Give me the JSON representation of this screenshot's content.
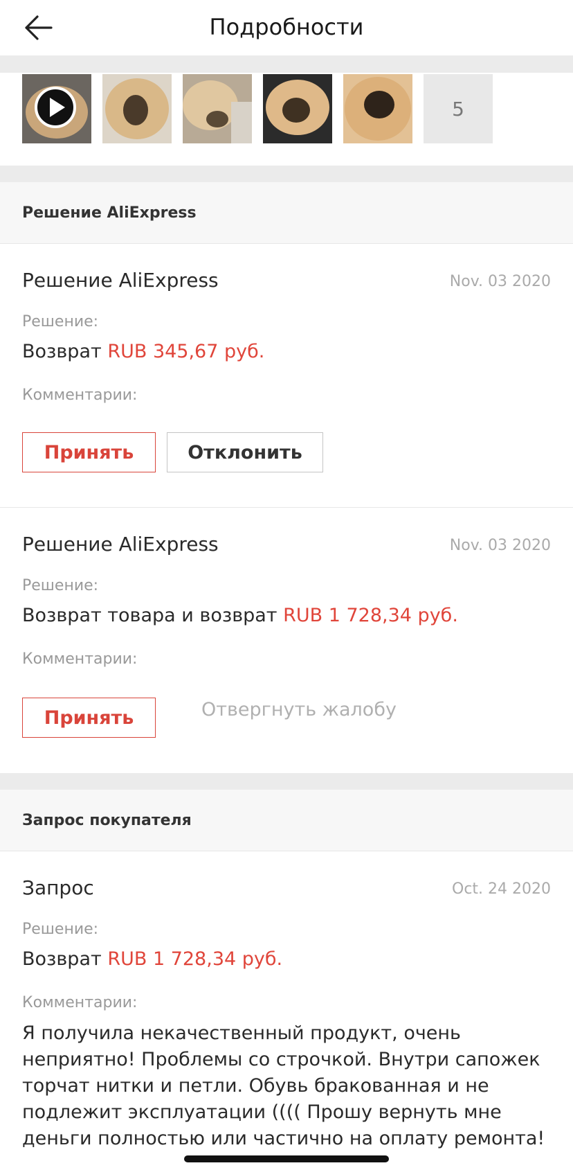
{
  "header": {
    "title": "Подробности"
  },
  "gallery": {
    "more_count": "5",
    "video_thumb_index": 0
  },
  "section_decision": {
    "heading": "Решение AliExpress",
    "items": [
      {
        "title": "Решение AliExpress",
        "date": "Nov. 03 2020",
        "decision_label": "Решение:",
        "decision_text": "Возврат ",
        "amount": "RUB 345,67 руб.",
        "comments_label": "Комментарии:",
        "accept_label": "Принять",
        "decline_label": "Отклонить"
      },
      {
        "title": "Решение AliExpress",
        "date": "Nov. 03 2020",
        "decision_label": "Решение:",
        "decision_text": "Возврат товара и возврат ",
        "amount": "RUB 1 728,34 руб.",
        "comments_label": "Комментарии:",
        "accept_label": "Принять",
        "reject_label": "Отвергнуть жалобу"
      }
    ]
  },
  "section_request": {
    "heading": "Запрос покупателя",
    "item": {
      "title": "Запрос",
      "date": "Oct. 24 2020",
      "decision_label": "Решение:",
      "decision_text": "Возврат ",
      "amount": "RUB 1 728,34 руб.",
      "comments_label": "Комментарии:",
      "comment": "Я получила некачественный продукт, очень неприятно! Проблемы со строчкой. Внутри сапожек торчат нитки и петли. Обувь бракованная и не подлежит эксплуатации (((( Прошу вернуть мне деньги полностью или частично на оплату ремонта!"
    }
  },
  "colors": {
    "accent": "#d9443a",
    "amount": "#e0453a",
    "muted": "#999999"
  }
}
